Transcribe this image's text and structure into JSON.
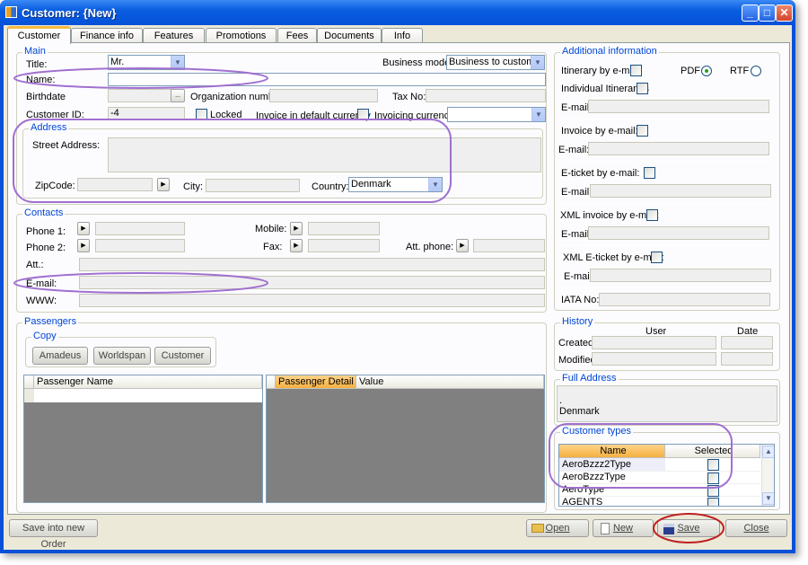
{
  "window": {
    "title": "Customer: {New}",
    "controls": [
      "_",
      "□",
      "✕"
    ]
  },
  "tabs": [
    {
      "label": "Customer",
      "active": true
    },
    {
      "label": "Finance info"
    },
    {
      "label": "Features"
    },
    {
      "label": "Promotions"
    },
    {
      "label": "Fees"
    },
    {
      "label": "Documents"
    },
    {
      "label": "Info"
    }
  ],
  "main": {
    "group": "Main",
    "title_label": "Title:",
    "title_value": "Mr.",
    "business_model_label": "Business model:",
    "business_model_value": "Business to customer",
    "name_label": "Name:",
    "name_value": "",
    "birthdate_label": "Birthdate",
    "birthdate_button": "...",
    "org_number_label": "Organization number:",
    "tax_no_label": "Tax No:",
    "customer_id_label": "Customer ID:",
    "customer_id_value": "-4",
    "locked_label": "Locked",
    "invoice_default_currency_label": "Invoice in default currency",
    "invoicing_currency_label": "Invoicing currency",
    "invoicing_currency_value": ""
  },
  "address": {
    "group": "Address",
    "street_label": "Street Address:",
    "zip_label": "ZipCode:",
    "city_label": "City:",
    "country_label": "Country:",
    "country_value": "Denmark"
  },
  "contacts": {
    "group": "Contacts",
    "phone1": "Phone 1:",
    "mobile": "Mobile:",
    "phone2": "Phone 2:",
    "fax": "Fax:",
    "att_phone": "Att. phone:",
    "att": "Att.:",
    "email": "E-mail:",
    "www": "WWW:"
  },
  "passengers": {
    "group": "Passengers",
    "copy_group": "Copy",
    "buttons": [
      "Amadeus",
      "Worldspan",
      "Customer"
    ],
    "grid_header": "Passenger Name",
    "detail_headers": [
      "Passenger Detail",
      "Value"
    ]
  },
  "additional": {
    "group": "Additional information",
    "itinerary": "Itinerary by e-mail:",
    "pdf": "PDF",
    "rtf": "RTF",
    "format_selected": "PDF",
    "individual": "Individual Itineraries",
    "email": "E-mail:",
    "invoice": "Invoice by e-mail:",
    "eticket": "E-ticket by e-mail:",
    "xml_invoice": "XML invoice by e-mail:",
    "xml_eticket": "XML E-ticket by e-mail:",
    "iata": "IATA No:"
  },
  "history": {
    "group": "History",
    "user": "User",
    "date": "Date",
    "created": "Created",
    "modified": "Modified"
  },
  "full_address": {
    "group": "Full Address",
    "line1": ".",
    "line2": "Denmark"
  },
  "customer_types": {
    "group": "Customer types",
    "headers": [
      "Name",
      "Selected"
    ],
    "rows": [
      {
        "name": "AeroBzzz2Type",
        "selected": false
      },
      {
        "name": "AeroBzzzType",
        "selected": false
      },
      {
        "name": "AeroType",
        "selected": false
      },
      {
        "name": "AGENTS",
        "selected": false
      }
    ]
  },
  "footer": {
    "save_new_order": "Save into new Order",
    "open": "Open",
    "new": "New",
    "save": "Save",
    "close": "Close"
  },
  "colors": {
    "annotation_purple": "#a070d0",
    "annotation_red": "#c02020",
    "accent_orange": "#f5b040",
    "group_title": "#0046d5"
  }
}
